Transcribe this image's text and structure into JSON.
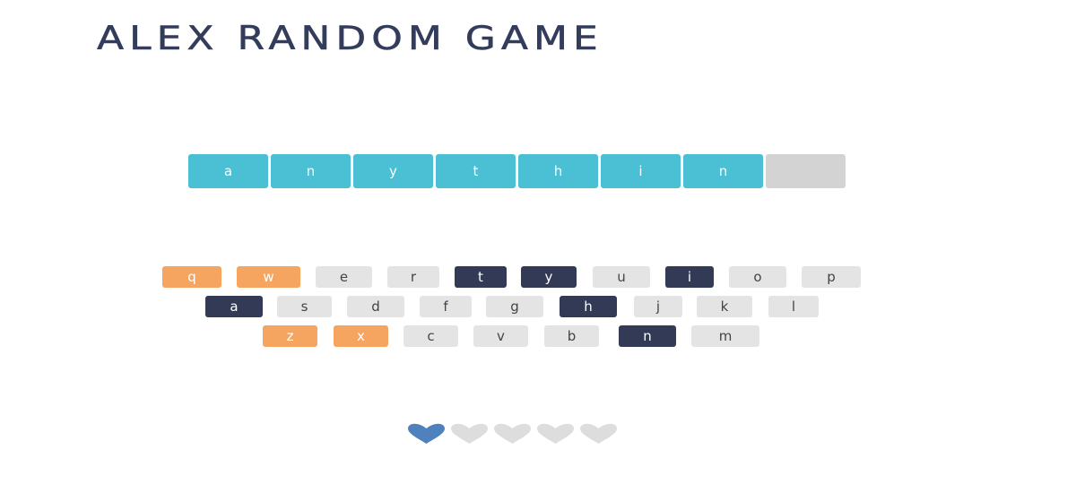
{
  "title": "ALEX RANDOM GAME",
  "word_slots": [
    {
      "letter": "a",
      "state": "revealed"
    },
    {
      "letter": "n",
      "state": "revealed"
    },
    {
      "letter": "y",
      "state": "revealed"
    },
    {
      "letter": "t",
      "state": "revealed"
    },
    {
      "letter": "h",
      "state": "revealed"
    },
    {
      "letter": "i",
      "state": "revealed"
    },
    {
      "letter": "n",
      "state": "revealed"
    },
    {
      "letter": "",
      "state": "empty"
    }
  ],
  "keyboard": {
    "row1": [
      {
        "letter": "q",
        "state": "wrong"
      },
      {
        "letter": "w",
        "state": "wrong"
      },
      {
        "letter": "e",
        "state": "unused"
      },
      {
        "letter": "r",
        "state": "unused"
      },
      {
        "letter": "t",
        "state": "correct"
      },
      {
        "letter": "y",
        "state": "correct"
      },
      {
        "letter": "u",
        "state": "unused"
      },
      {
        "letter": "i",
        "state": "correct"
      },
      {
        "letter": "o",
        "state": "unused"
      },
      {
        "letter": "p",
        "state": "unused"
      }
    ],
    "row2": [
      {
        "letter": "a",
        "state": "correct"
      },
      {
        "letter": "s",
        "state": "unused"
      },
      {
        "letter": "d",
        "state": "unused"
      },
      {
        "letter": "f",
        "state": "unused"
      },
      {
        "letter": "g",
        "state": "unused"
      },
      {
        "letter": "h",
        "state": "correct"
      },
      {
        "letter": "j",
        "state": "unused"
      },
      {
        "letter": "k",
        "state": "unused"
      },
      {
        "letter": "l",
        "state": "unused"
      }
    ],
    "row3": [
      {
        "letter": "z",
        "state": "wrong"
      },
      {
        "letter": "x",
        "state": "wrong"
      },
      {
        "letter": "c",
        "state": "unused"
      },
      {
        "letter": "v",
        "state": "unused"
      },
      {
        "letter": "b",
        "state": "unused"
      },
      {
        "letter": "n",
        "state": "correct"
      },
      {
        "letter": "m",
        "state": "unused"
      }
    ]
  },
  "lives": {
    "total": 5,
    "remaining": 1
  },
  "colors": {
    "slot_revealed": "#4bbfd4",
    "slot_empty": "#d3d3d3",
    "key_correct": "#333a56",
    "key_wrong": "#f5a55f",
    "key_unused": "#e4e4e4",
    "heart_full": "#4f81bd",
    "heart_empty": "#dddddd"
  }
}
